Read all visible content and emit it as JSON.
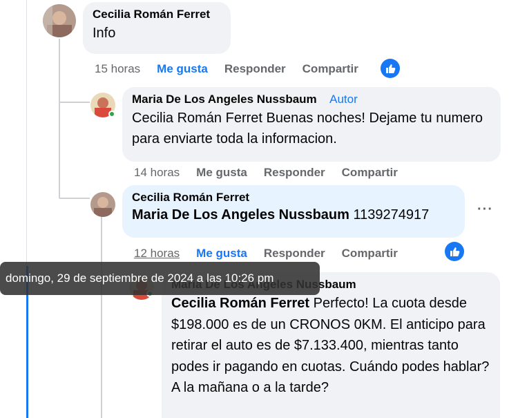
{
  "comments": [
    {
      "author": "Cecilia Román Ferret",
      "text": "Info",
      "time": "15 horas",
      "like_label": "Me gusta",
      "reply_label": "Responder",
      "share_label": "Compartir"
    },
    {
      "author": "Maria De Los Angeles Nussbaum",
      "badge": "Autor",
      "mention": "Cecilia Román Ferret",
      "text": " Buenas noches! Dejame tu numero para enviarte toda la informacion.",
      "time": "14 horas",
      "like_label": "Me gusta",
      "reply_label": "Responder",
      "share_label": "Compartir"
    },
    {
      "author": "Cecilia Román Ferret",
      "mention": "Maria De Los Angeles Nussbaum",
      "text": " 1139274917",
      "time": "12 horas",
      "like_label": "Me gusta",
      "reply_label": "Responder",
      "share_label": "Compartir",
      "more": "···"
    },
    {
      "author": "Maria De Los Angeles Nussbaum",
      "mention": "Cecilia Román Ferret",
      "text": " Perfecto! La cuota desde $198.000 es de un CRONOS 0KM. El anticipo para retirar el auto es de $7.133.400, mientras tanto podes ir pagando en cuotas. Cuándo podes hablar? A la mañana o a la tarde?"
    }
  ],
  "tooltip": "domingo, 29 de septiembre de 2024 a las 10:26 pm",
  "colors": {
    "accent": "#1877f2",
    "bubble": "#f0f2f5",
    "highlight": "#e7f3ff",
    "muted": "#65676b"
  }
}
